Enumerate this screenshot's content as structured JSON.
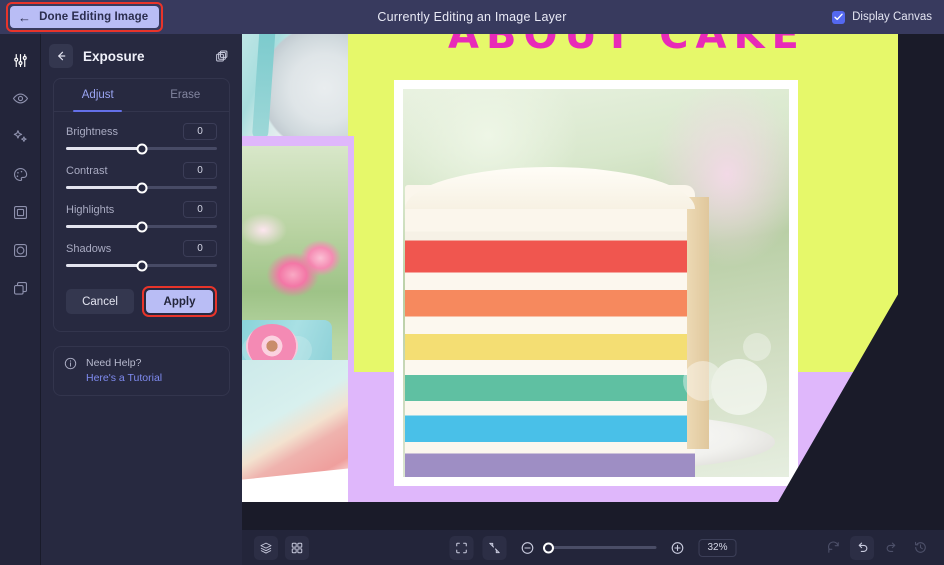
{
  "topbar": {
    "done_label": "Done Editing Image",
    "back_arrow_icon": "arrow-left-icon",
    "title": "Currently Editing an Image Layer",
    "display_canvas_label": "Display Canvas",
    "display_canvas_checked": true,
    "accent_highlight": "#e8342a",
    "bar_color": "#383a5e",
    "button_color": "#b9bdf5"
  },
  "rail": {
    "items": [
      {
        "name": "adjust-icon",
        "selected": true
      },
      {
        "name": "eye-icon",
        "selected": false
      },
      {
        "name": "sparkles-icon",
        "selected": false
      },
      {
        "name": "palette-icon",
        "selected": false
      },
      {
        "name": "frame-icon",
        "selected": false
      },
      {
        "name": "vignette-icon",
        "selected": false
      },
      {
        "name": "layers-duplicate-icon",
        "selected": false
      }
    ]
  },
  "panel": {
    "back_icon": "arrow-left-icon",
    "title": "Exposure",
    "copy_icon": "duplicate-layers-icon",
    "tabs": [
      {
        "label": "Adjust",
        "active": true
      },
      {
        "label": "Erase",
        "active": false
      }
    ],
    "sliders": [
      {
        "label": "Brightness",
        "value": "0",
        "position": 50
      },
      {
        "label": "Contrast",
        "value": "0",
        "position": 50
      },
      {
        "label": "Highlights",
        "value": "0",
        "position": 50
      },
      {
        "label": "Shadows",
        "value": "0",
        "position": 50
      }
    ],
    "cancel_label": "Cancel",
    "apply_label": "Apply",
    "help": {
      "icon": "info-icon",
      "line1": "Need Help?",
      "line2": "Here's a Tutorial",
      "link_color": "#7f8bf0"
    }
  },
  "canvas": {
    "title_text": "ABOUT CAKE",
    "title_color": "#e82ab8",
    "background_color": "#e6f86a",
    "accent_purple": "#dfb7fb",
    "stage_color": "#1a1b29",
    "photos": [
      {
        "name": "photo-teal-plate"
      },
      {
        "name": "photo-pink-flowers"
      },
      {
        "name": "photo-table-cloth"
      },
      {
        "name": "photo-rainbow-cake-slice"
      }
    ]
  },
  "bottombar": {
    "layers_icon": "layers-icon",
    "grid_icon": "grid-icon",
    "fit-screen_icon": "fit-screen-icon",
    "collapse_icon": "collapse-icon",
    "zoom_out_icon": "zoom-out-icon",
    "zoom_in_icon": "zoom-in-icon",
    "zoom_value": "32%",
    "zoom_slider_position": 0,
    "reset_icon": "reset-icon",
    "undo_icon": "undo-icon",
    "redo_icon": "redo-icon",
    "history_icon": "history-icon"
  }
}
